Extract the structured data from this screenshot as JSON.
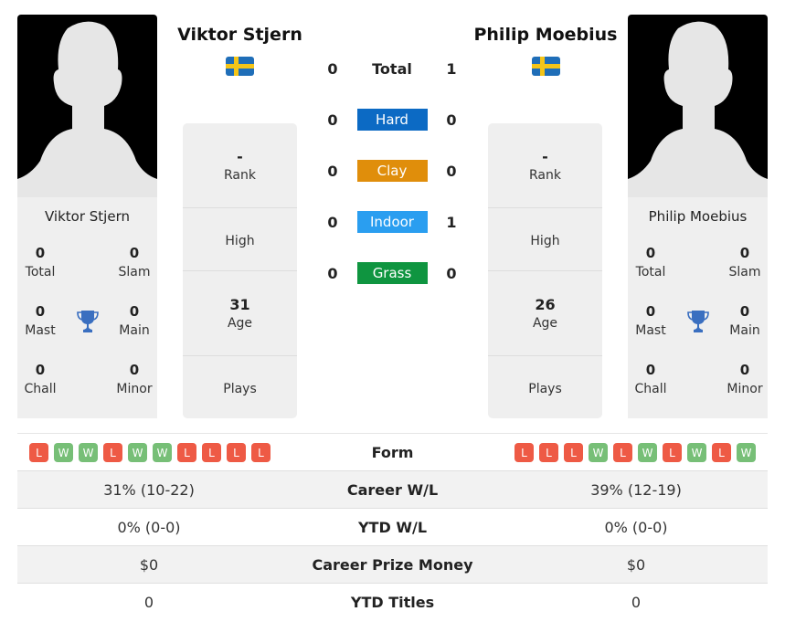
{
  "player1": {
    "name": "Viktor Stjern",
    "flag": "sweden-flag",
    "titles": [
      {
        "value": "0",
        "label": "Total"
      },
      {
        "value": "0",
        "label": "Slam"
      },
      {
        "value": "0",
        "label": "Mast"
      },
      {
        "value": "0",
        "label": "Main"
      },
      {
        "value": "0",
        "label": "Chall"
      },
      {
        "value": "0",
        "label": "Minor"
      }
    ],
    "info": {
      "rank_value": "-",
      "rank_label": "Rank",
      "high_value": "",
      "high_label": "High",
      "age_value": "31",
      "age_label": "Age",
      "plays_value": "",
      "plays_label": "Plays"
    },
    "form": [
      "L",
      "W",
      "W",
      "L",
      "W",
      "W",
      "L",
      "L",
      "L",
      "L"
    ]
  },
  "player2": {
    "name": "Philip Moebius",
    "flag": "sweden-flag",
    "titles": [
      {
        "value": "0",
        "label": "Total"
      },
      {
        "value": "0",
        "label": "Slam"
      },
      {
        "value": "0",
        "label": "Mast"
      },
      {
        "value": "0",
        "label": "Main"
      },
      {
        "value": "0",
        "label": "Chall"
      },
      {
        "value": "0",
        "label": "Minor"
      }
    ],
    "info": {
      "rank_value": "-",
      "rank_label": "Rank",
      "high_value": "",
      "high_label": "High",
      "age_value": "26",
      "age_label": "Age",
      "plays_value": "",
      "plays_label": "Plays"
    },
    "form": [
      "L",
      "L",
      "L",
      "W",
      "L",
      "W",
      "L",
      "W",
      "L",
      "W"
    ]
  },
  "h2h": [
    {
      "label": "Total",
      "p1": "0",
      "p2": "1",
      "color": null
    },
    {
      "label": "Hard",
      "p1": "0",
      "p2": "0",
      "color": "#0c6ac4"
    },
    {
      "label": "Clay",
      "p1": "0",
      "p2": "0",
      "color": "#e08e0b"
    },
    {
      "label": "Indoor",
      "p1": "0",
      "p2": "1",
      "color": "#2a9ef0"
    },
    {
      "label": "Grass",
      "p1": "0",
      "p2": "0",
      "color": "#0f9540"
    }
  ],
  "form_label": "Form",
  "stats": [
    {
      "label": "Career W/L",
      "p1": "31% (10-22)",
      "p2": "39% (12-19)"
    },
    {
      "label": "YTD W/L",
      "p1": "0% (0-0)",
      "p2": "0% (0-0)"
    },
    {
      "label": "Career Prize Money",
      "p1": "$0",
      "p2": "$0"
    },
    {
      "label": "YTD Titles",
      "p1": "0",
      "p2": "0"
    }
  ],
  "colors": {
    "win": "#77bf77",
    "loss": "#ee5a45",
    "trophy": "#3a6fc0"
  }
}
